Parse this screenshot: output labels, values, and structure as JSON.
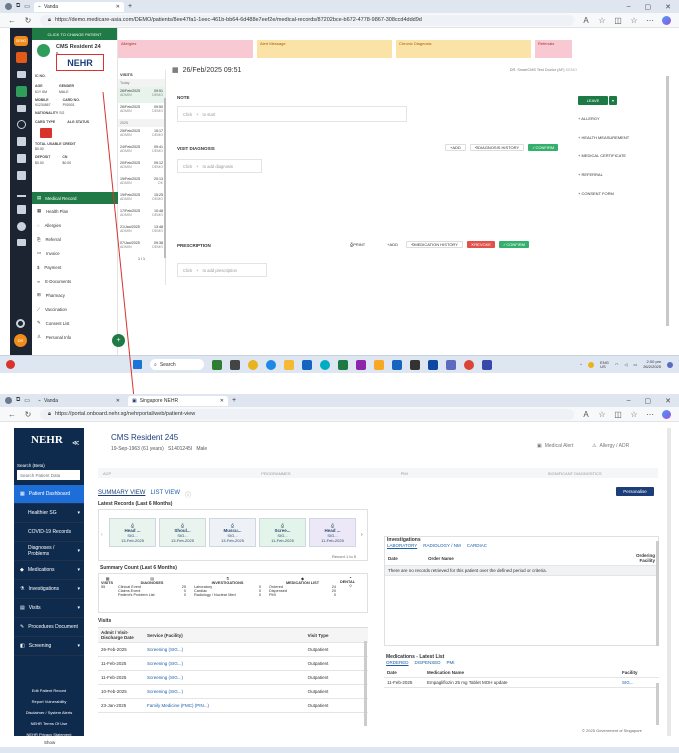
{
  "top": {
    "tab_title": "Vanda",
    "url": "https://demo.medicare-asia.com/DEMO/patients/8ee47fa1-1eec-461b-bb64-6d488e7eef2e/medical-records/87202bce-b672-4778-9867-308ccd4ddd9d",
    "change_patient": "CLICK TO CHANGE PATIENT",
    "patient_name": "CMS Resident 24",
    "patient_sub": "5",
    "nehr_badge": "NEHR",
    "alerts": [
      {
        "label": "Allergies",
        "color": "#f8c9d2"
      },
      {
        "label": "Alert Message",
        "color": "#fbe3a8"
      },
      {
        "label": "Chronic Diagnosis",
        "color": "#fbe3a8"
      },
      {
        "label": "Referrals",
        "color": "#f8c9d2"
      }
    ],
    "patient_info": [
      {
        "k": "IC NO.",
        "v": ""
      },
      {
        "k": "AGE",
        "v": "61Y 6M"
      },
      {
        "k": "GENDER",
        "v": "MALE"
      },
      {
        "k": "MOBILE",
        "v": "91234567"
      },
      {
        "k": "CARD NO.",
        "v": "P00001"
      },
      {
        "k": "NATIONALITY",
        "v": "SG"
      },
      {
        "k": "CARD TYPE",
        "v": ""
      },
      {
        "k": "ALG STATUS",
        "v": ""
      },
      {
        "k": "TOTAL USABLE CREDIT",
        "v": "$0.00"
      },
      {
        "k": "DEPOSIT",
        "v": "$0.00"
      },
      {
        "k": "CN",
        "v": "$0.00"
      }
    ],
    "menu": [
      "Medical Record",
      "Health Plan",
      "Allergies",
      "Referral",
      "Invoice",
      "Payment",
      "E-Documents",
      "Pharmacy",
      "Vaccination",
      "Consent List",
      "Personal Info"
    ],
    "visits_header": "VISITS",
    "visit_groups": [
      {
        "label": "Today",
        "items": [
          {
            "date": "26/Feb/2025",
            "time": "09:51",
            "a": "ADMIN",
            "b": "DEMO"
          }
        ]
      },
      {
        "label": "",
        "items": [
          {
            "date": "26/Feb/2025",
            "time": "09:50",
            "a": "ADMIN",
            "b": "DEMO"
          }
        ]
      },
      {
        "label": "2025",
        "items": [
          {
            "date": "25/Feb/2025",
            "time": "15:17",
            "a": "ADMIN",
            "b": "DEMO"
          },
          {
            "date": "24/Feb/2025",
            "time": "09:41",
            "a": "ADMIN",
            "b": "DEMO"
          },
          {
            "date": "20/Feb/2025",
            "time": "09:12",
            "a": "ADMIN",
            "b": "DEMO"
          },
          {
            "date": "19/Feb/2025",
            "time": "20:13",
            "a": "ADMIN",
            "b": "OK"
          },
          {
            "date": "19/Feb/2025",
            "time": "15:25",
            "a": "ADMIN",
            "b": "DEMO"
          },
          {
            "date": "17/Feb/2025",
            "time": "10:48",
            "a": "ADMIN",
            "b": "DEMO"
          },
          {
            "date": "21/Jan/2025",
            "time": "13:48",
            "a": "ADMIN",
            "b": "DEMO"
          },
          {
            "date": "07/Jan/2025",
            "time": "09:38",
            "a": "ADMIN",
            "b": "DEMO"
          }
        ]
      }
    ],
    "pager": "1 / 1",
    "record_date": "26/Feb/2025 09:51",
    "doctor": "DR. SmartCMS Test Doctor (AF)",
    "edit": "EDIT",
    "note": "NOTE",
    "click_start": "Click",
    "to_start": "to start",
    "visit_diagnosis": "VISIT DIAGNOSIS",
    "add": "ADD",
    "diag_history": "DIAGNOSIS HISTORY",
    "confirm": "CONFIRM",
    "to_add_diag": "to add diagnosis",
    "prescription": "PRESCRIPTION",
    "print": "PRINT",
    "med_history": "MEDICATION HISTORY",
    "revoke": "REVOKE",
    "to_add_presc": "to add prescription",
    "leave": "LEAVE",
    "right_links": [
      "ALLERGY",
      "HEALTH MEASUREMENT",
      "MEDICAL CERTIFICATE",
      "REFERRAL",
      "CONSENT FORM"
    ],
    "search": "Search",
    "tray_lang": "ENG\nUS",
    "tray_time": "2:00 pm",
    "tray_date": "26/2/2025"
  },
  "bottom": {
    "tab1": "Vanda",
    "tab2": "Singapore NEHR",
    "url": "https://portal.onboard.nehr.sg/nehrportal/web/patient-view",
    "logo": "NEHR",
    "search_label": "Search (Beta)",
    "search_placeholder": "Search Patient Data",
    "nav": [
      "Patient Dashboard",
      "Healthier SG",
      "COVID-19 Records",
      "Diagnoses / Problems",
      "Medications",
      "Investigations",
      "Visits",
      "Procedures Document",
      "Screening",
      "Edit Patient Record",
      "Report Vulnerability",
      "Disclaimer / System Alerts",
      "NEHR Terms Of Use",
      "NEHR Privacy Statement"
    ],
    "patient_name": "CMS Resident 245",
    "patient_meta": "19-Sep-1963 (61 years)   S1401245I   Male",
    "medical_alert": "Medical Alert",
    "allergy_adr": "Allergy / ADR",
    "flags": [
      "ACP",
      "PROGRAMMES",
      "PMI",
      "SIGNIFICANT DIAGNOSTICS"
    ],
    "view_summary": "SUMMARY VIEW",
    "view_list": "LIST VIEW",
    "personalise": "Personalise",
    "latest_title": "Latest Records (Last 6 Months)",
    "cards": [
      {
        "t": "Head ...",
        "s": "SIG...",
        "d": "13-Feb-2025"
      },
      {
        "t": "Shoul...",
        "s": "SIG...",
        "d": "13-Feb-2025"
      },
      {
        "t": "Muscu...",
        "s": "SIG...",
        "d": "13-Feb-2025"
      },
      {
        "t": "Scree...",
        "s": "SIG...",
        "d": "11-Feb-2025"
      },
      {
        "t": "Head ...",
        "s": "SIG...",
        "d": "11-Feb-2025"
      }
    ],
    "record_count": "Record 1 to 5",
    "summary_title": "Summary Count (Last 6 Months)",
    "summary_cols": [
      {
        "h": "VISITS",
        "rows": [
          [
            "55",
            ""
          ]
        ]
      },
      {
        "h": "DIAGNOSES",
        "rows": [
          [
            "Clinical Event",
            "25"
          ],
          [
            "Claims Event",
            "0"
          ],
          [
            "Patient's Problem List",
            "0"
          ]
        ]
      },
      {
        "h": "INVESTIGATIONS",
        "rows": [
          [
            "Laboratory",
            "0"
          ],
          [
            "Cardiac",
            "0"
          ],
          [
            "Radiology / Nuclear Med",
            "0"
          ]
        ]
      },
      {
        "h": "MEDICATION LIST",
        "rows": [
          [
            "Ordered",
            "24"
          ],
          [
            "Dispensed",
            "20"
          ],
          [
            "PMI",
            "0"
          ]
        ]
      },
      {
        "h": "DENTAL",
        "rows": [
          [
            "0",
            ""
          ]
        ]
      }
    ],
    "visits_title": "Visits",
    "visits_head": [
      "Admit / Visit-Discharge Date",
      "Service (Facility)",
      "Visit Type"
    ],
    "visits_rows": [
      [
        "26-Feb-2025",
        "Screening (SIG...)",
        "Outpatient"
      ],
      [
        "11-Feb-2025",
        "Screening (SIG...)",
        "Outpatient"
      ],
      [
        "11-Feb-2025",
        "Screening (SIG...)",
        "Outpatient"
      ],
      [
        "10-Feb-2025",
        "Screening (SIG...)",
        "Outpatient"
      ],
      [
        "23-Jan-2025",
        "Family Medicine (FMC) (PIN...)",
        "Outpatient"
      ]
    ],
    "inv_title": "Investigations",
    "inv_tabs": [
      "LABORATORY",
      "RADIOLOGY / NM",
      "CARDIAC"
    ],
    "inv_head": [
      "Date",
      "Order Name",
      "Ordering Facility"
    ],
    "inv_empty": "There are no records retrieved for this patient over the defined period or criteria.",
    "med_title": "Medications - Latest List",
    "med_tabs": [
      "ORDERED",
      "DISPENSED",
      "PMI"
    ],
    "med_head": [
      "Date",
      "Medication Name",
      "Facility"
    ],
    "med_rows": [
      [
        "11-Feb-2025",
        "Empagliflozin 25 mg Tablet MOH update",
        "SIG..."
      ]
    ],
    "footer": "© 2025 Government of Singapore",
    "show": "Show"
  }
}
